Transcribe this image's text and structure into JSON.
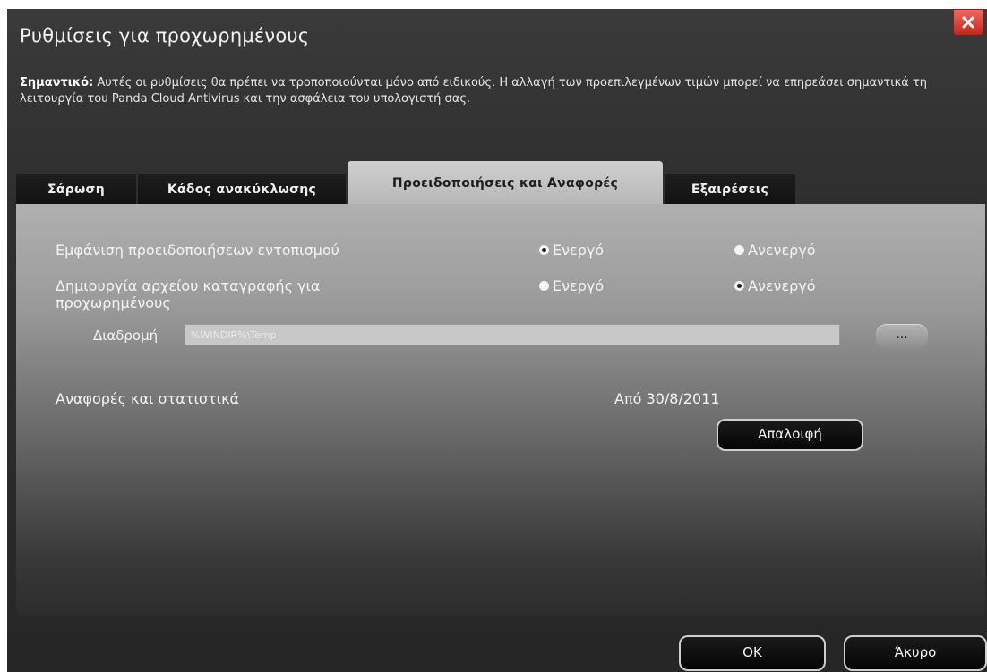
{
  "window": {
    "title": "Ρυθμίσεις για προχωρημένους"
  },
  "warning": {
    "bold": "Σημαντικό:",
    "text": " Αυτές οι ρυθμίσεις θα πρέπει να τροποποιούνται μόνο από ειδικούς. Η αλλαγή των προεπιλεγμένων τιμών μπορεί να επηρεάσει σημαντικά τη λειτουργία του Panda Cloud Antivirus και την ασφάλεια του υπολογιστή σας."
  },
  "tabs": [
    {
      "label": "Σάρωση",
      "active": false
    },
    {
      "label": "Κάδος ανακύκλωσης",
      "active": false
    },
    {
      "label": "Προειδοποιήσεις και Αναφορές",
      "active": true
    },
    {
      "label": "Εξαιρέσεις",
      "active": false
    }
  ],
  "settings": {
    "detection_alerts": {
      "label": "Εμφάνιση προειδοποιήσεων εντοπισμού",
      "on_label": "Ενεργό",
      "off_label": "Ανενεργό",
      "selected": "on"
    },
    "advanced_log": {
      "label": "Δημιουργία αρχείου καταγραφής για προχωρημένους",
      "on_label": "Ενεργό",
      "off_label": "Ανενεργό",
      "selected": "off"
    },
    "path": {
      "label": "Διαδρομή",
      "value": "%WINDIR%\\Temp",
      "browse_label": "..."
    },
    "stats": {
      "label": "Αναφορές και στατιστικά",
      "date": "Από 30/8/2011",
      "clear_label": "Απαλοιφή"
    }
  },
  "footer": {
    "ok_label": "OK",
    "cancel_label": "Άκυρο"
  },
  "colors": {
    "close_button": "#d0332a",
    "active_tab": "#c4c4c4",
    "window_bg": "#2f2f2f"
  }
}
